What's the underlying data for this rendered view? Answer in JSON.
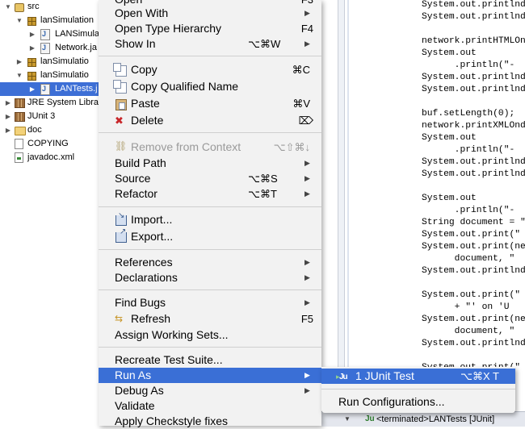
{
  "tree": {
    "rows": [
      {
        "label": "src",
        "icon": "package-folder-icon",
        "twisty": "▼"
      },
      {
        "label": "lanSimulation",
        "icon": "package-icon",
        "twisty": "▼"
      },
      {
        "label": "LANSimula",
        "icon": "java-file-icon",
        "twisty": "▶"
      },
      {
        "label": "Network.ja",
        "icon": "java-file-icon",
        "twisty": "▶"
      },
      {
        "label": "lanSimulatio",
        "icon": "package-icon",
        "twisty": "▶"
      },
      {
        "label": "lanSimulatio",
        "icon": "package-icon",
        "twisty": "▼"
      },
      {
        "label": "LANTests.j",
        "icon": "java-file-icon",
        "twisty": "▶",
        "selected": true
      },
      {
        "label": "JRE System Library",
        "icon": "library-icon",
        "twisty": "▶"
      },
      {
        "label": "JUnit 3",
        "icon": "library-icon",
        "twisty": "▶"
      },
      {
        "label": "doc",
        "icon": "folder-icon",
        "twisty": "▶"
      },
      {
        "label": "COPYING",
        "icon": "file-icon",
        "twisty": ""
      },
      {
        "label": "javadoc.xml",
        "icon": "xml-file-icon",
        "twisty": ""
      }
    ]
  },
  "menu": {
    "open": {
      "label": "Open",
      "shortcut": "F3"
    },
    "open_with": {
      "label": "Open With"
    },
    "open_type_hierarchy": {
      "label": "Open Type Hierarchy",
      "shortcut": "F4"
    },
    "show_in": {
      "label": "Show In",
      "shortcut": "⌥⌘W"
    },
    "copy": {
      "label": "Copy",
      "shortcut": "⌘C"
    },
    "copy_qualified_name": {
      "label": "Copy Qualified Name"
    },
    "paste": {
      "label": "Paste",
      "shortcut": "⌘V"
    },
    "delete": {
      "label": "Delete",
      "shortcut": "⌦"
    },
    "remove_from_context": {
      "label": "Remove from Context",
      "shortcut": "⌥⇧⌘↓"
    },
    "build_path": {
      "label": "Build Path"
    },
    "source": {
      "label": "Source",
      "shortcut": "⌥⌘S"
    },
    "refactor": {
      "label": "Refactor",
      "shortcut": "⌥⌘T"
    },
    "import": {
      "label": "Import..."
    },
    "export": {
      "label": "Export..."
    },
    "references": {
      "label": "References"
    },
    "declarations": {
      "label": "Declarations"
    },
    "find_bugs": {
      "label": "Find Bugs"
    },
    "refresh": {
      "label": "Refresh",
      "shortcut": "F5"
    },
    "assign_working_sets": {
      "label": "Assign Working Sets..."
    },
    "recreate_test_suite": {
      "label": "Recreate Test Suite..."
    },
    "run_as": {
      "label": "Run As"
    },
    "debug_as": {
      "label": "Debug As"
    },
    "validate": {
      "label": "Validate"
    },
    "apply_checkstyle": {
      "label": "Apply Checkstyle fixes"
    }
  },
  "submenu": {
    "junit_test": {
      "label": "1 JUnit Test",
      "shortcut": "⌥⌘X T"
    },
    "run_configurations": {
      "label": "Run Configurations..."
    }
  },
  "code": {
    "lines": [
      "System.out.printlnd",
      "System.out.printlnd",
      "",
      "network.printHTMLOn",
      "System.out",
      "      .println(\"-",
      "System.out.printlnd",
      "System.out.printlnd",
      "",
      "buf.setLength(0);",
      "network.printXMLOnd",
      "System.out",
      "      .println(\"-",
      "System.out.printlnd",
      "System.out.printlnd",
      "",
      "System.out",
      "      .println(\"-",
      "String document = \"",
      "System.out.print(\"",
      "System.out.print(ne",
      "      document, \"",
      "System.out.printlnd",
      "",
      "System.out.print(\"",
      "      + \"' on 'U",
      "System.out.print(ne",
      "      document, \"",
      "System.out.printlnd",
      "",
      "System.out.print(\""
    ]
  },
  "junit_bar": {
    "prefix": "Ju",
    "status": "<terminated>LANTests [JUnit]"
  },
  "colors": {
    "selection": "#3a6fd6",
    "menu_bg": "#f2f2f2"
  }
}
